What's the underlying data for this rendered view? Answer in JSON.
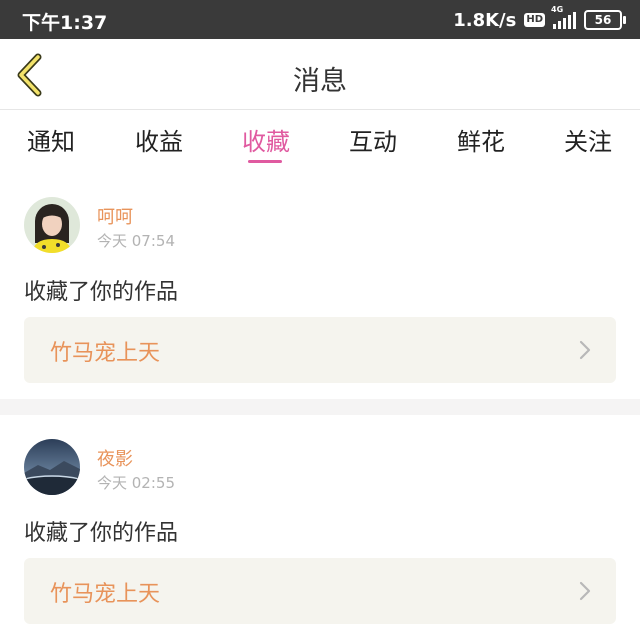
{
  "status_bar": {
    "time": "下午1:37",
    "net_speed": "1.8K/s",
    "hd": "HD",
    "network": "4G",
    "battery": "56"
  },
  "header": {
    "title": "消息"
  },
  "tabs": [
    {
      "label": "通知",
      "active": false
    },
    {
      "label": "收益",
      "active": false
    },
    {
      "label": "收藏",
      "active": true
    },
    {
      "label": "互动",
      "active": false
    },
    {
      "label": "鲜花",
      "active": false
    },
    {
      "label": "关注",
      "active": false
    }
  ],
  "messages": [
    {
      "username": "呵呵",
      "time": "今天 07:54",
      "text": "收藏了你的作品",
      "work_title": "竹马宠上天"
    },
    {
      "username": "夜影",
      "time": "今天 02:55",
      "text": "收藏了你的作品",
      "work_title": "竹马宠上天"
    }
  ],
  "colors": {
    "accent": "#e05aa0",
    "username": "#e8935a",
    "card_bg": "#f5f4ee",
    "status_bar_bg": "#3a3a3a"
  }
}
